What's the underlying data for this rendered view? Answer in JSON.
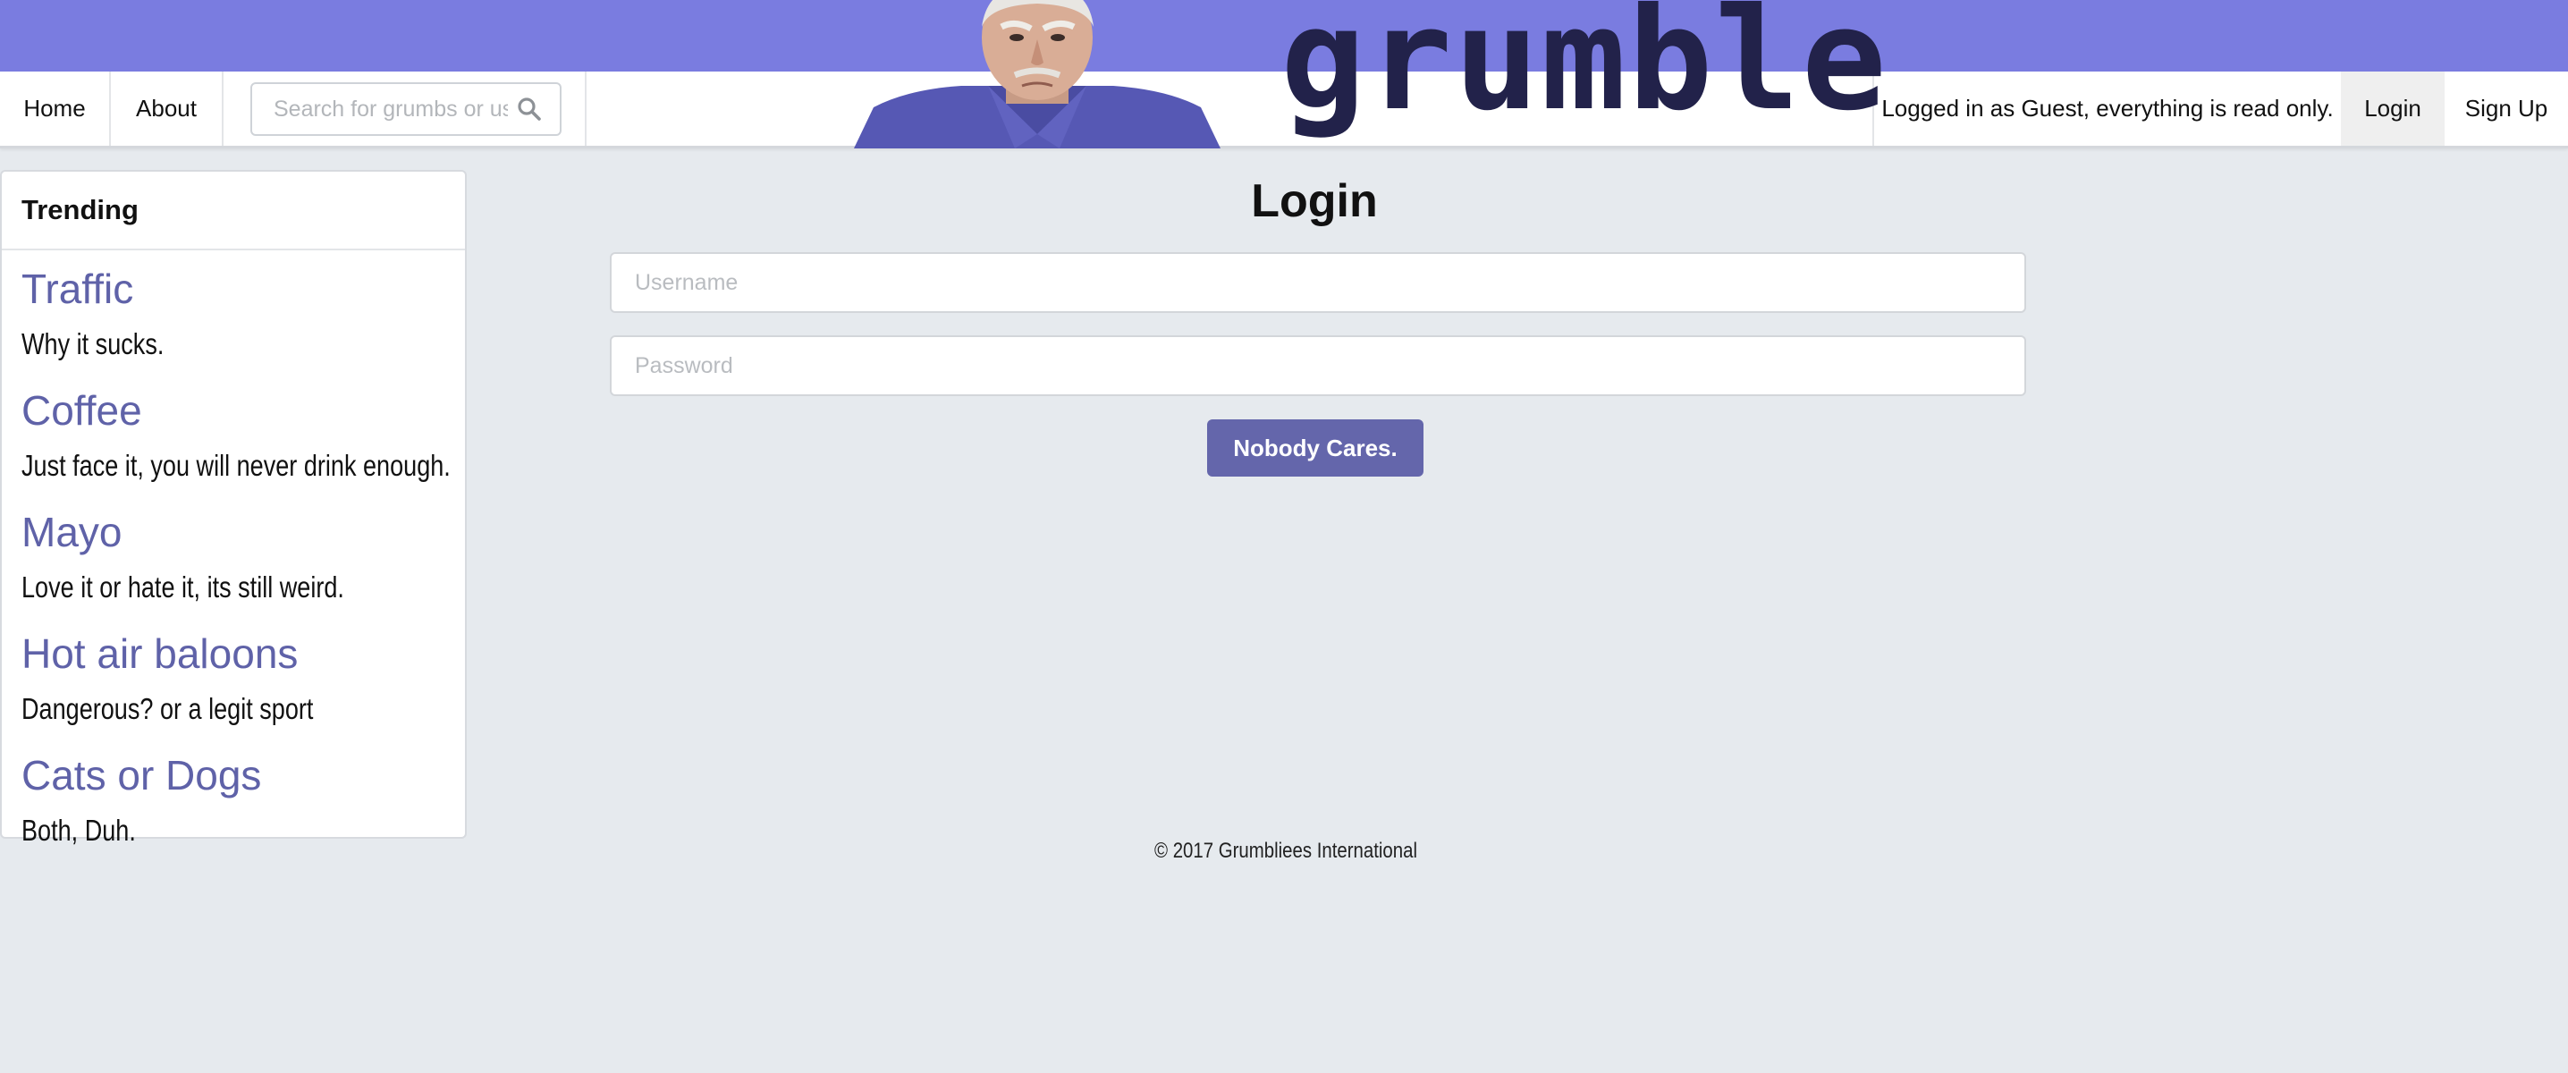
{
  "nav": {
    "home": "Home",
    "about": "About",
    "search_placeholder": "Search for grumbs or users",
    "status": "Logged in as Guest, everything is read only.",
    "login": "Login",
    "signup": "Sign Up"
  },
  "logo": {
    "text": "grumble"
  },
  "trending": {
    "heading": "Trending",
    "items": [
      {
        "title": "Traffic",
        "desc": "Why it sucks."
      },
      {
        "title": "Coffee",
        "desc": "Just face it, you will never drink enough."
      },
      {
        "title": "Mayo",
        "desc": "Love it or hate it, its still weird."
      },
      {
        "title": "Hot air baloons",
        "desc": "Dangerous? or a legit sport"
      },
      {
        "title": "Cats or Dogs",
        "desc": "Both, Duh."
      }
    ]
  },
  "login": {
    "title": "Login",
    "username_placeholder": "Username",
    "password_placeholder": "Password",
    "submit": "Nobody Cares."
  },
  "footer": {
    "text": "© 2017 Grumbliees International"
  },
  "colors": {
    "banner": "#7a7ce0",
    "accent": "#6466ab",
    "link": "#5f62a8",
    "background": "#e6eaee"
  }
}
